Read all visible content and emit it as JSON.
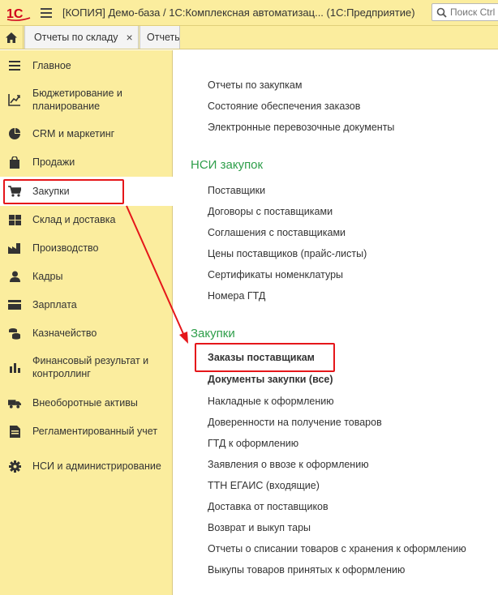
{
  "titlebar": {
    "logo_text": "1С",
    "title": "[КОПИЯ] Демо-база / 1С:Комплексная автоматизац...  (1С:Предприятие)",
    "search_placeholder": "Поиск Ctrl"
  },
  "tabs": [
    {
      "label": "Отчеты по складу",
      "close": "×"
    },
    {
      "label": "Отчеты"
    }
  ],
  "sidebar": {
    "items": [
      {
        "label": "Главное",
        "icon": "menu-lines-icon"
      },
      {
        "label": "Бюджетирование и планирование",
        "icon": "budget-chart-icon"
      },
      {
        "label": "CRM и маркетинг",
        "icon": "pie-chart-icon"
      },
      {
        "label": "Продажи",
        "icon": "shopping-bag-icon"
      },
      {
        "label": "Закупки",
        "icon": "cart-icon",
        "active": true
      },
      {
        "label": "Склад и доставка",
        "icon": "warehouse-grid-icon"
      },
      {
        "label": "Производство",
        "icon": "factory-icon"
      },
      {
        "label": "Кадры",
        "icon": "person-icon"
      },
      {
        "label": "Зарплата",
        "icon": "wallet-icon"
      },
      {
        "label": "Казначейство",
        "icon": "coins-icon"
      },
      {
        "label": "Финансовый результат и контроллинг",
        "icon": "bar-chart-icon"
      },
      {
        "label": "Внеоборотные активы",
        "icon": "truck-icon"
      },
      {
        "label": "Регламентированный учет",
        "icon": "document-icon"
      },
      {
        "label": "НСИ и администрирование",
        "icon": "gear-icon"
      }
    ]
  },
  "main": {
    "top_links": [
      "Отчеты по закупкам",
      "Состояние обеспечения заказов",
      "Электронные перевозочные документы"
    ],
    "nsi_title": "НСИ закупок",
    "nsi_links": [
      "Поставщики",
      "Договоры с поставщиками",
      "Соглашения с поставщиками",
      "Цены поставщиков (прайс-листы)",
      "Сертификаты номенклатуры",
      "Номера ГТД"
    ],
    "purchases_title": "Закупки",
    "purchases_links": [
      "Заказы поставщикам",
      "Документы закупки (все)",
      "Накладные к оформлению",
      "Доверенности на получение товаров",
      "ГТД к оформлению",
      "Заявления о ввозе к оформлению",
      "ТТН ЕГАИС (входящие)",
      "Доставка от поставщиков",
      "Возврат и выкуп тары",
      "Отчеты о списании товаров с хранения к оформлению",
      "Выкупы товаров принятых к оформлению"
    ]
  },
  "colors": {
    "panel_yellow": "#fbed9e",
    "section_green": "#2e9e4a",
    "annotation_red": "#e5161a",
    "logo_red": "#d0021b"
  }
}
